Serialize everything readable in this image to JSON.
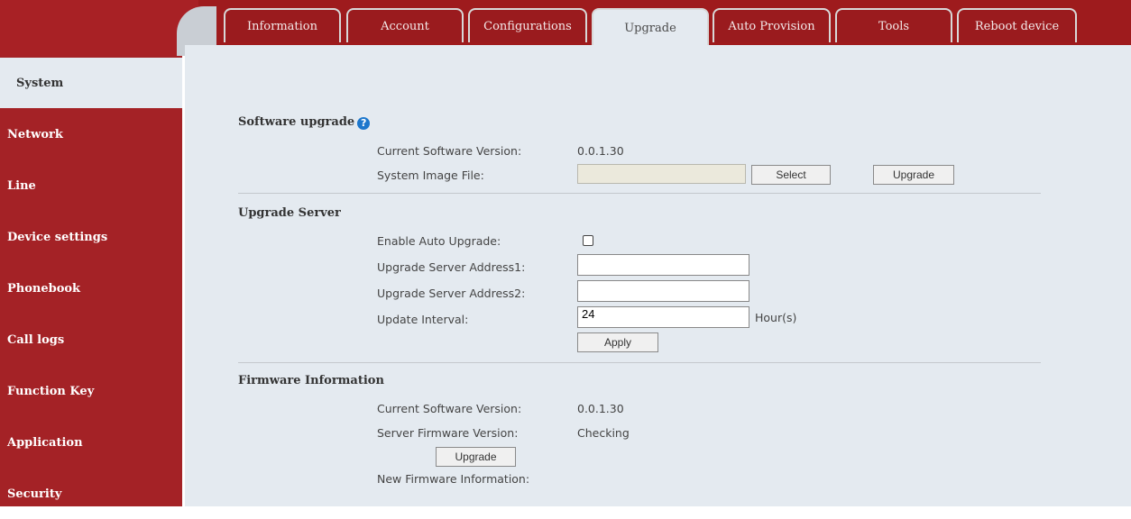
{
  "tabs": [
    {
      "label": "Information"
    },
    {
      "label": "Account"
    },
    {
      "label": "Configurations"
    },
    {
      "label": "Upgrade"
    },
    {
      "label": "Auto Provision"
    },
    {
      "label": "Tools"
    },
    {
      "label": "Reboot device"
    }
  ],
  "active_tab": "Upgrade",
  "sidebar": {
    "items": [
      {
        "label": "System"
      },
      {
        "label": "Network"
      },
      {
        "label": "Line"
      },
      {
        "label": "Device settings"
      },
      {
        "label": "Phonebook"
      },
      {
        "label": "Call logs"
      },
      {
        "label": "Function Key"
      },
      {
        "label": "Application"
      },
      {
        "label": "Security"
      }
    ],
    "active": "System"
  },
  "software_upgrade": {
    "title": "Software upgrade",
    "current_version_label": "Current Software Version:",
    "current_version_value": "0.0.1.30",
    "image_file_label": "System Image File:",
    "image_file_value": "",
    "select_button": "Select",
    "upgrade_button": "Upgrade"
  },
  "upgrade_server": {
    "title": "Upgrade Server",
    "enable_auto_label": "Enable Auto Upgrade:",
    "enable_auto_checked": false,
    "address1_label": "Upgrade Server Address1:",
    "address1_value": "",
    "address2_label": "Upgrade Server Address2:",
    "address2_value": "",
    "interval_label": "Update Interval:",
    "interval_value": "24",
    "interval_unit": "Hour(s)",
    "apply_button": "Apply"
  },
  "firmware_info": {
    "title": "Firmware Information",
    "current_version_label": "Current Software Version:",
    "current_version_value": "0.0.1.30",
    "server_version_label": "Server Firmware Version:",
    "server_version_value": "Checking",
    "upgrade_button": "Upgrade",
    "new_info_label": "New Firmware Information:"
  },
  "colors": {
    "brand_red": "#a42226",
    "content_bg": "#e4eaf0",
    "help_icon": "#1d77cc"
  }
}
